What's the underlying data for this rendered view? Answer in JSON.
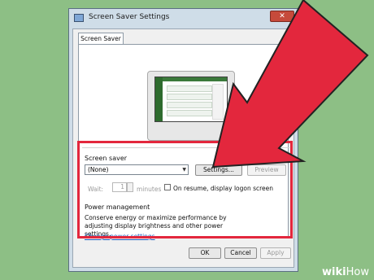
{
  "window": {
    "title": "Screen Saver Settings",
    "close_icon": "✕"
  },
  "tabs": [
    {
      "label": "Screen Saver"
    }
  ],
  "screen_saver": {
    "group_label": "Screen saver",
    "selected": "(None)",
    "settings_label": "Settings...",
    "preview_label": "Preview",
    "wait_label": "Wait:",
    "wait_value": "1",
    "minutes_label": "minutes",
    "resume_label": "On resume, display logon screen"
  },
  "power": {
    "group_label": "Power management",
    "description": "Conserve energy or maximize performance by adjusting display brightness and other power settings.",
    "link_text": "Change power settings"
  },
  "footer": {
    "ok": "OK",
    "cancel": "Cancel",
    "apply": "Apply"
  },
  "watermark": {
    "wiki": "wiki",
    "how": "How"
  },
  "colors": {
    "highlight": "#e3273d",
    "background": "#8dbf85"
  }
}
